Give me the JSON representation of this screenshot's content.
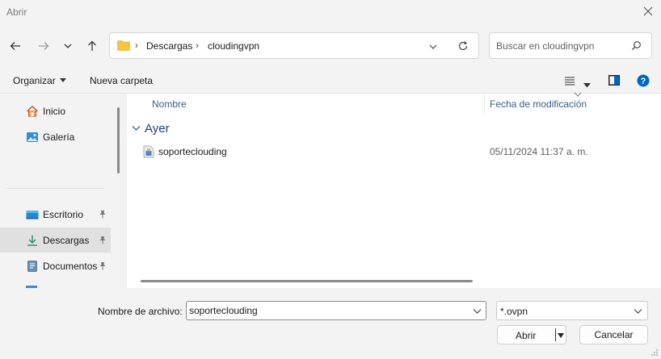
{
  "window": {
    "title": "Abrir"
  },
  "address": {
    "crumbs": [
      "Descargas",
      "cloudingvpn"
    ],
    "separator": "›"
  },
  "search": {
    "placeholder": "Buscar en cloudingvpn"
  },
  "toolbar": {
    "organize_label": "Organizar",
    "new_folder_label": "Nueva carpeta"
  },
  "sidebar": {
    "items": [
      {
        "label": "Inicio",
        "icon": "home-icon"
      },
      {
        "label": "Galería",
        "icon": "gallery-icon"
      },
      {
        "label": "Escritorio",
        "icon": "desktop-icon",
        "pinned": true
      },
      {
        "label": "Descargas",
        "icon": "downloads-icon",
        "pinned": true,
        "selected": true
      },
      {
        "label": "Documentos",
        "icon": "documents-icon",
        "pinned": true
      }
    ]
  },
  "columns": {
    "name": "Nombre",
    "modified": "Fecha de modificación"
  },
  "groups": [
    {
      "label": "Ayer",
      "files": [
        {
          "name": "soporteclouding",
          "modified": "05/11/2024 11:37 a. m.",
          "icon": "config-file-icon"
        }
      ]
    }
  ],
  "footer": {
    "filename_label": "Nombre de archivo:",
    "filename_value": "soporteclouding",
    "filetype_value": "*.ovpn",
    "open_label": "Abrir",
    "cancel_label": "Cancelar"
  },
  "colors": {
    "accent": "#0067c0",
    "group_header": "#1e3f73",
    "folder": "#f5c542"
  }
}
